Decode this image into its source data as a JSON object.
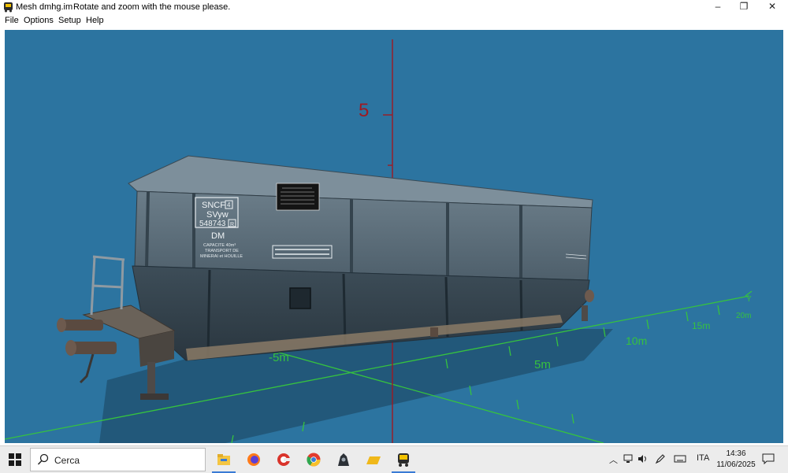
{
  "window": {
    "title_file": "Mesh dmhg.im",
    "title_hint": "Rotate and zoom with the mouse please.",
    "controls": {
      "minimize": "–",
      "restore": "❐",
      "close": "✕"
    }
  },
  "menu": {
    "items": [
      "File",
      "Options",
      "Setup",
      "Help"
    ]
  },
  "viewport": {
    "background": "#2c74a0",
    "axis_labels": {
      "z_tick": "5",
      "y_axis": "Y",
      "y_ticks": [
        "-5m",
        "5m",
        "10m",
        "15m",
        "20m"
      ]
    },
    "wagon_markings": {
      "line1": "SNCF",
      "line1_box": "4",
      "line2": "SVyw",
      "line3": "548743",
      "line3_box": "R",
      "code": "DM",
      "cap1": "CAPACITE 40m³",
      "cap2": "TRANSPORT DE",
      "cap3": "MINERAI et HOUILLE"
    }
  },
  "taskbar": {
    "search_placeholder": "Cerca",
    "apps": [
      "file-explorer",
      "firefox",
      "ccleaner",
      "chrome",
      "app-dark",
      "folder",
      "train-viewer"
    ],
    "tray": {
      "language": "ITA",
      "time": "14:36",
      "date": "11/06/2025"
    }
  },
  "colors": {
    "viewport_bg": "#2c74a0",
    "axis_red": "#9e1a22",
    "grid_green": "#36c23f",
    "body_grey": "#5a6c78"
  }
}
